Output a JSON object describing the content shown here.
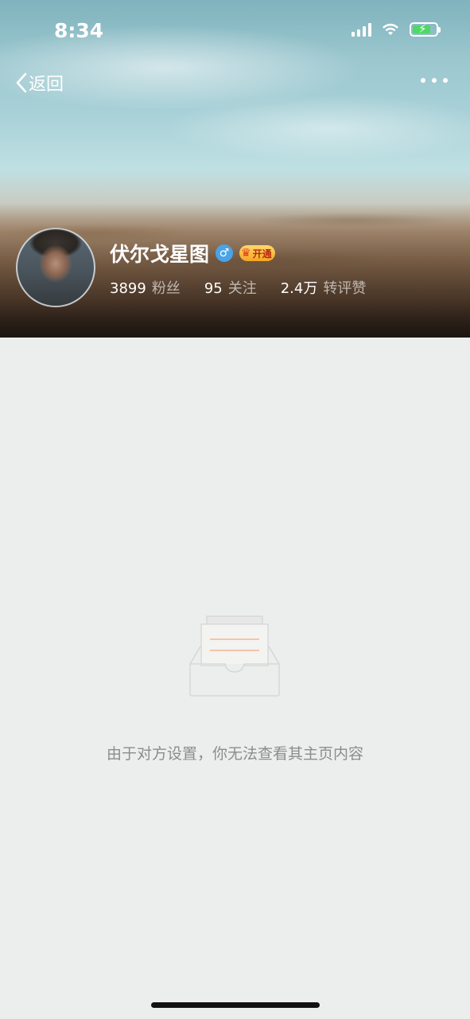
{
  "status_bar": {
    "time": "8:34"
  },
  "nav": {
    "back_label": "返回",
    "more_icon": "more-dots-icon"
  },
  "profile": {
    "name": "伏尔戈星图",
    "gender_symbol": "♂",
    "vip_label": "开通",
    "stats": [
      {
        "value": "3899",
        "label": "粉丝"
      },
      {
        "value": "95",
        "label": "关注"
      },
      {
        "value": "2.4万",
        "label": "转评赞"
      }
    ]
  },
  "empty_state": {
    "message": "由于对方设置，你无法查看其主页内容"
  },
  "colors": {
    "gender_badge": "#4aa3e6",
    "vip_badge": "#f5a623",
    "battery": "#4cd964"
  }
}
